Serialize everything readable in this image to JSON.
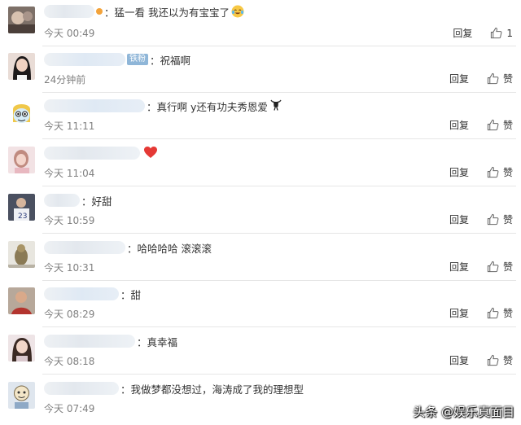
{
  "actions": {
    "reply_label": "回复",
    "like_label": "赞",
    "like_icon": "thumbs-up-icon"
  },
  "comments": [
    {
      "text": "：猛一看 我还以为有宝宝了",
      "emoji": "laughing-crying-emoji",
      "time": "今天 00:49",
      "likes": "1"
    },
    {
      "badge": "铁粉",
      "text": "：祝福啊",
      "time": "24分钟前",
      "likes": "赞"
    },
    {
      "text": "：真行啊 y还有功夫秀恩爱",
      "emoji": "bull-emoji",
      "time": "今天 11:11",
      "likes": "赞"
    },
    {
      "text": "",
      "emoji": "red-heart-emoji",
      "time": "今天 11:04",
      "likes": "赞"
    },
    {
      "text": "：好甜",
      "time": "今天 10:59",
      "likes": "赞"
    },
    {
      "text": "：哈哈哈哈 滚滚滚",
      "time": "今天 10:31",
      "likes": "赞"
    },
    {
      "text": "：甜",
      "time": "今天 08:29",
      "likes": "赞"
    },
    {
      "text": "：真幸福",
      "time": "今天 08:18",
      "likes": "赞"
    },
    {
      "text": "：我做梦都没想过，海涛成了我的理想型",
      "time": "今天 07:49",
      "likes": "赞"
    }
  ],
  "watermark": "头条 @娱乐真面目",
  "colors": {
    "timestamp": "#808080",
    "divider": "#e6e6e6",
    "heart": "#e53935"
  }
}
